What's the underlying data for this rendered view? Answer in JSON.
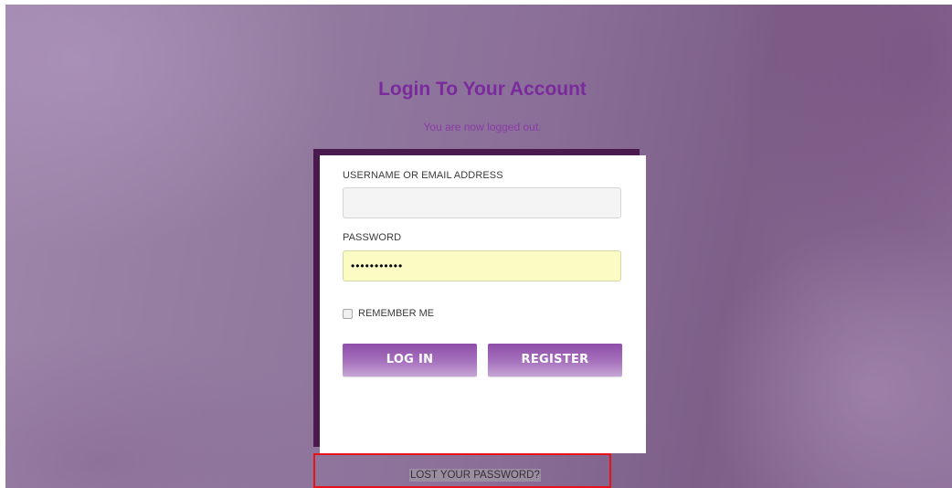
{
  "login": {
    "title": "Login To Your Account",
    "status_message": "You are now logged out.",
    "username_label": "USERNAME OR EMAIL ADDRESS",
    "username_value": "",
    "password_label": "PASSWORD",
    "password_value": "•••••••••••",
    "remember_label": "REMEMBER ME",
    "remember_checked": false,
    "login_button": "LOG IN",
    "register_button": "REGISTER",
    "lost_password_link": "LOST YOUR PASSWORD?"
  },
  "colors": {
    "title": "#7a2a9c",
    "card_shadow": "#4a1a4e",
    "button": "#a672bd",
    "password_field": "#fafcc4",
    "highlight_box": "#e8131a"
  }
}
